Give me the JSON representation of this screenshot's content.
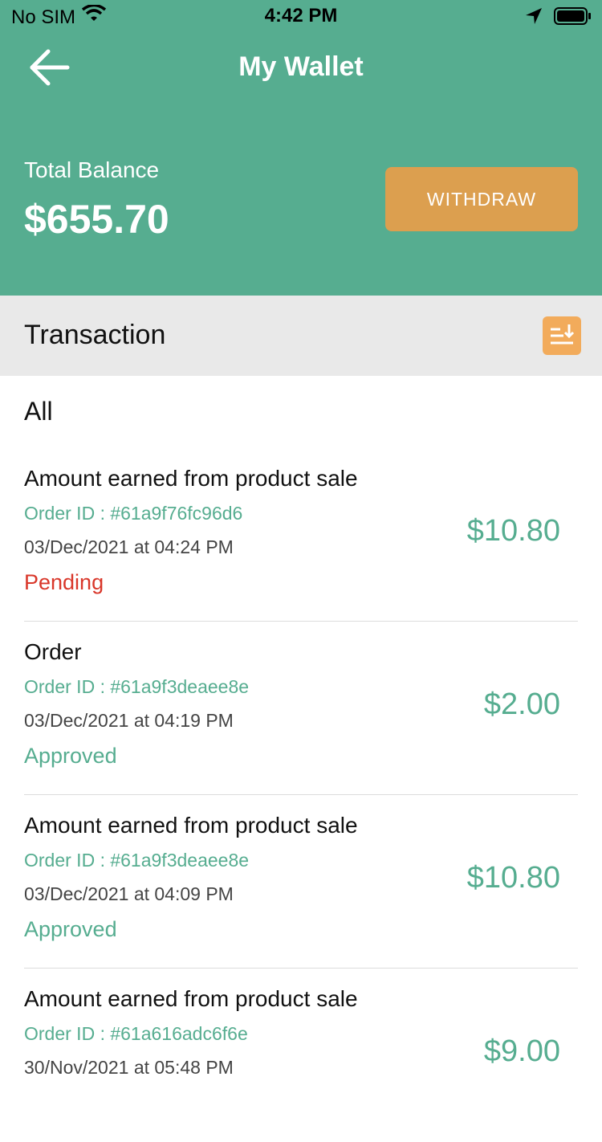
{
  "status_bar": {
    "carrier": "No SIM",
    "time": "4:42 PM"
  },
  "header": {
    "title": "My Wallet"
  },
  "balance": {
    "label": "Total Balance",
    "amount": "$655.70",
    "withdraw_label": "WITHDRAW"
  },
  "transactions": {
    "title": "Transaction",
    "filter_label": "All",
    "items": [
      {
        "title": "Amount earned from product sale",
        "order_id": "Order ID : #61a9f76fc96d6",
        "datetime": "03/Dec/2021 at 04:24 PM",
        "status": "Pending",
        "amount": "$10.80"
      },
      {
        "title": "Order",
        "order_id": "Order ID : #61a9f3deaee8e",
        "datetime": "03/Dec/2021 at 04:19 PM",
        "status": "Approved",
        "amount": "$2.00"
      },
      {
        "title": "Amount earned from product sale",
        "order_id": "Order ID : #61a9f3deaee8e",
        "datetime": "03/Dec/2021 at 04:09 PM",
        "status": "Approved",
        "amount": "$10.80"
      },
      {
        "title": "Amount earned from product sale",
        "order_id": "Order ID : #61a616adc6f6e",
        "datetime": "30/Nov/2021 at 05:48 PM",
        "status": "",
        "amount": "$9.00"
      }
    ]
  },
  "colors": {
    "primary": "#56ad90",
    "accent": "#dc9f4f",
    "pending": "#d9372a"
  }
}
